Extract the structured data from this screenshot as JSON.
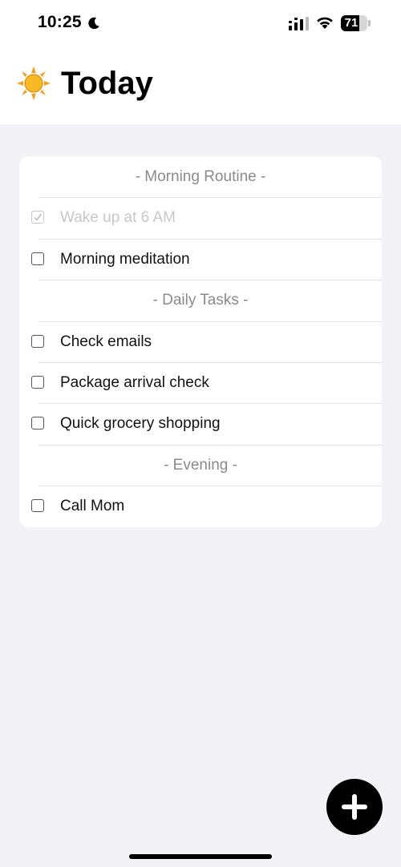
{
  "status_bar": {
    "time": "10:25",
    "battery_level": "71",
    "battery_fraction": 0.71,
    "icons": [
      "moon-icon",
      "signal-icon",
      "wifi-icon",
      "battery-icon"
    ]
  },
  "header": {
    "title": "Today",
    "icon": "sun-icon"
  },
  "list": {
    "sections": [
      {
        "title": "- Morning Routine -",
        "tasks": [
          {
            "label": "Wake up at 6 AM",
            "checked": true
          },
          {
            "label": "Morning meditation",
            "checked": false
          }
        ]
      },
      {
        "title": "- Daily Tasks -",
        "tasks": [
          {
            "label": "Check emails",
            "checked": false
          },
          {
            "label": "Package arrival check",
            "checked": false
          },
          {
            "label": "Quick grocery shopping",
            "checked": false
          }
        ]
      },
      {
        "title": "- Evening -",
        "tasks": [
          {
            "label": "Call Mom",
            "checked": false
          }
        ]
      }
    ]
  },
  "fab": {
    "icon": "plus-icon"
  },
  "colors": {
    "background": "#f2f2f7",
    "card": "#ffffff",
    "section_header_text": "#8a8a8e",
    "done_text": "#c7c7cc",
    "accent": "#000000"
  }
}
